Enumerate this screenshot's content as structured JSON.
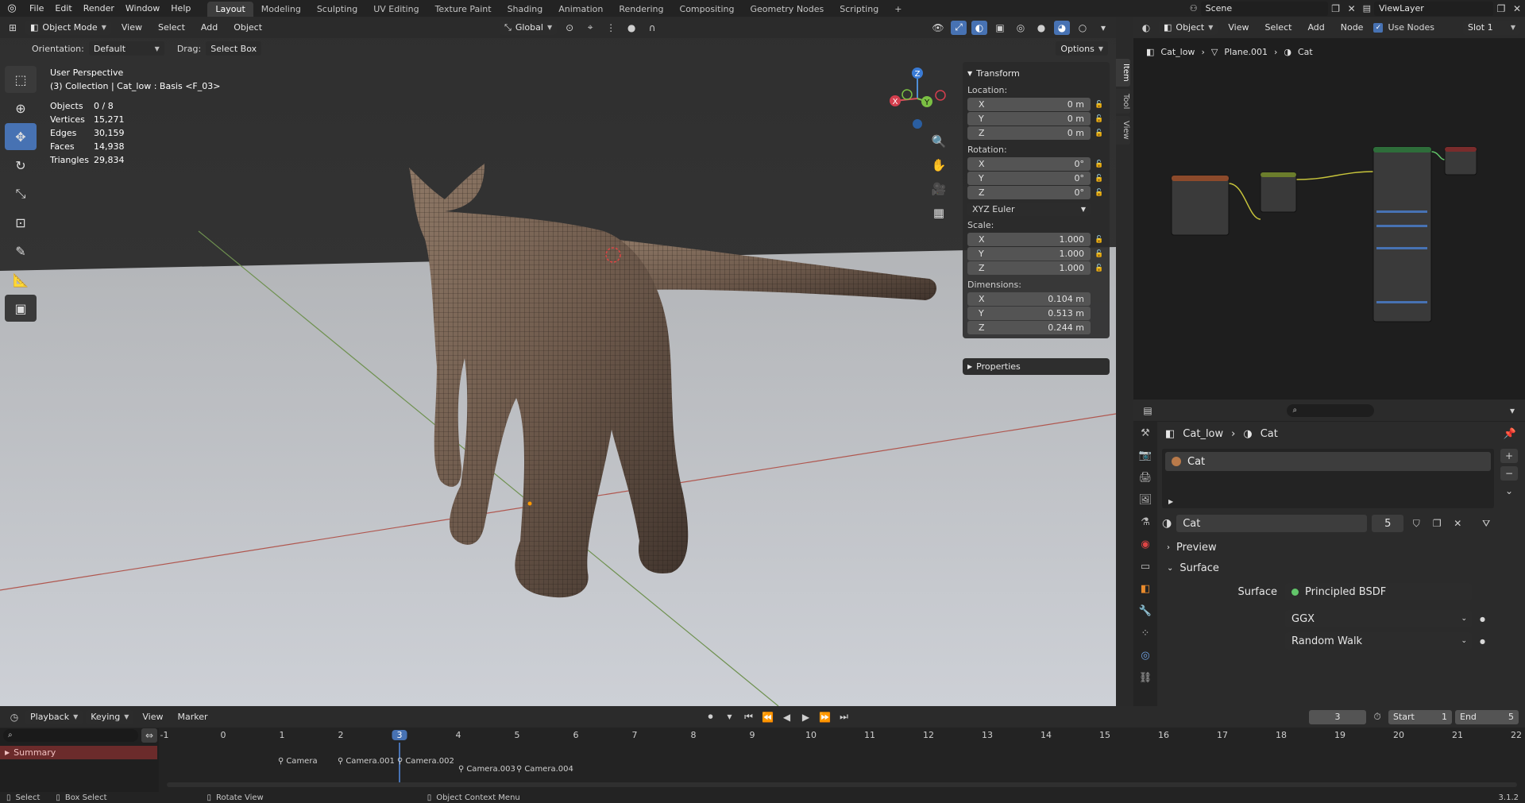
{
  "menu": {
    "items": [
      "File",
      "Edit",
      "Render",
      "Window",
      "Help"
    ],
    "workspaces": [
      "Layout",
      "Modeling",
      "Sculpting",
      "UV Editing",
      "Texture Paint",
      "Shading",
      "Animation",
      "Rendering",
      "Compositing",
      "Geometry Nodes",
      "Scripting"
    ],
    "active_workspace": "Layout",
    "add_tab": "+",
    "scene": "Scene",
    "view_layer": "ViewLayer"
  },
  "viewport": {
    "mode": "Object Mode",
    "menus": [
      "View",
      "Select",
      "Add",
      "Object"
    ],
    "transform": "Global",
    "orientation_label": "Orientation:",
    "orientation_value": "Default",
    "drag_label": "Drag:",
    "drag_value": "Select Box",
    "options": "Options",
    "perspective": "User Perspective",
    "collection": "(3) Collection | Cat_low : Basis <F_03>",
    "stats": [
      {
        "label": "Objects",
        "value": "0 / 8"
      },
      {
        "label": "Vertices",
        "value": "15,271"
      },
      {
        "label": "Edges",
        "value": "30,159"
      },
      {
        "label": "Faces",
        "value": "14,938"
      },
      {
        "label": "Triangles",
        "value": "29,834"
      }
    ],
    "gizmo": {
      "x": "X",
      "y": "Y",
      "z": "Z"
    }
  },
  "npanel": {
    "transform": "Transform",
    "location_label": "Location:",
    "location": [
      {
        "axis": "X",
        "value": "0 m"
      },
      {
        "axis": "Y",
        "value": "0 m"
      },
      {
        "axis": "Z",
        "value": "0 m"
      }
    ],
    "rotation_label": "Rotation:",
    "rotation": [
      {
        "axis": "X",
        "value": "0°"
      },
      {
        "axis": "Y",
        "value": "0°"
      },
      {
        "axis": "Z",
        "value": "0°"
      }
    ],
    "rotation_mode": "XYZ Euler",
    "scale_label": "Scale:",
    "scale": [
      {
        "axis": "X",
        "value": "1.000"
      },
      {
        "axis": "Y",
        "value": "1.000"
      },
      {
        "axis": "Z",
        "value": "1.000"
      }
    ],
    "dimensions_label": "Dimensions:",
    "dimensions": [
      {
        "axis": "X",
        "value": "0.104 m"
      },
      {
        "axis": "Y",
        "value": "0.513 m"
      },
      {
        "axis": "Z",
        "value": "0.244 m"
      }
    ],
    "properties": "Properties",
    "tabs": [
      "Item",
      "Tool",
      "View"
    ]
  },
  "node_editor": {
    "mode": "Object",
    "menus": [
      "View",
      "Select",
      "Add",
      "Node"
    ],
    "use_nodes": "Use Nodes",
    "slot": "Slot 1",
    "breadcrumb": [
      "Cat_low",
      "Plane.001",
      "Cat"
    ]
  },
  "properties": {
    "breadcrumb": [
      "Cat_low",
      "Cat"
    ],
    "material_slot": "Cat",
    "material_name": "Cat",
    "users": "5",
    "preview": "Preview",
    "surface_section": "Surface",
    "surface_label": "Surface",
    "surface_value": "Principled BSDF",
    "distribution": "GGX",
    "subsurface": "Random Walk"
  },
  "timeline": {
    "menus": [
      "Playback",
      "Keying",
      "View",
      "Marker"
    ],
    "current_frame": "3",
    "start_label": "Start",
    "start": "1",
    "end_label": "End",
    "end": "5",
    "frames": [
      "-1",
      "0",
      "1",
      "2",
      "3",
      "4",
      "5",
      "6",
      "7",
      "8",
      "9",
      "10",
      "11",
      "12",
      "13",
      "14",
      "15",
      "16",
      "17",
      "18",
      "19",
      "20",
      "21",
      "22"
    ],
    "summary": "Summary",
    "markers": [
      "Camera",
      "Camera.001",
      "Camera.002",
      "Camera.003",
      "Camera.004"
    ]
  },
  "status": {
    "select": "Select",
    "box_select": "Box Select",
    "rotate_view": "Rotate View",
    "context_menu": "Object Context Menu",
    "version": "3.1.2"
  }
}
